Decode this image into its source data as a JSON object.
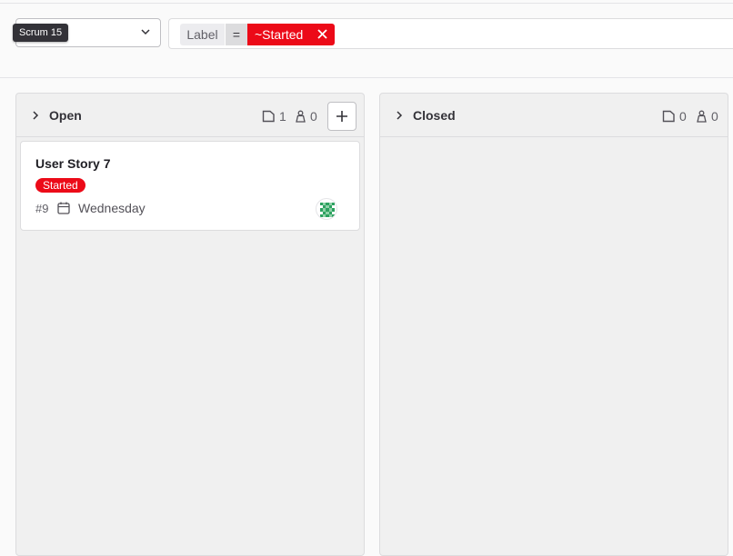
{
  "tooltip": {
    "text": "Scrum 15"
  },
  "filter": {
    "token_label": "Label",
    "token_operator": "=",
    "token_value": "~Started"
  },
  "columns": [
    {
      "title": "Open",
      "issue_count": "1",
      "user_count": "0"
    },
    {
      "title": "Closed",
      "issue_count": "0",
      "user_count": "0"
    }
  ],
  "card": {
    "title": "User Story 7",
    "badge": "Started",
    "ref": "#9",
    "due_date": "Wednesday"
  },
  "colors": {
    "label_red": "#ec0a18",
    "avatar_green": "#2da160"
  },
  "icons": [
    "chevron-down-icon",
    "close-icon",
    "chevron-right-icon",
    "issues-icon",
    "weight-icon",
    "plus-icon",
    "calendar-icon",
    "avatar-identicon"
  ]
}
